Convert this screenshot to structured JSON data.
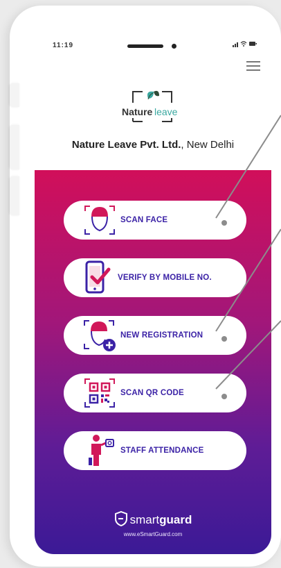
{
  "status_bar": {
    "time": "11:19",
    "signal_icon": "signal-wifi-battery-icons"
  },
  "header": {
    "menu_icon": "hamburger-menu-icon",
    "logo": {
      "word1": "Nature",
      "word2": "leave"
    },
    "company_name": "Nature Leave Pvt. Ltd.",
    "company_location": ", New Delhi"
  },
  "actions": [
    {
      "label": "SCAN FACE",
      "icon": "face-scan-icon"
    },
    {
      "label": "VERIFY BY MOBILE NO.",
      "icon": "mobile-check-icon"
    },
    {
      "label": "NEW REGISTRATION",
      "icon": "face-add-icon"
    },
    {
      "label": "SCAN QR CODE",
      "icon": "qr-code-icon"
    },
    {
      "label": "STAFF ATTENDANCE",
      "icon": "staff-attendance-icon"
    }
  ],
  "footer": {
    "brand_light": "smart",
    "brand_bold": "guard",
    "url": "www.eSmartGuard.com"
  },
  "colors": {
    "gradient_top": "#d10f5a",
    "gradient_bottom": "#3b1a96",
    "button_text": "#3b22a6",
    "accent_red": "#d1185a"
  }
}
